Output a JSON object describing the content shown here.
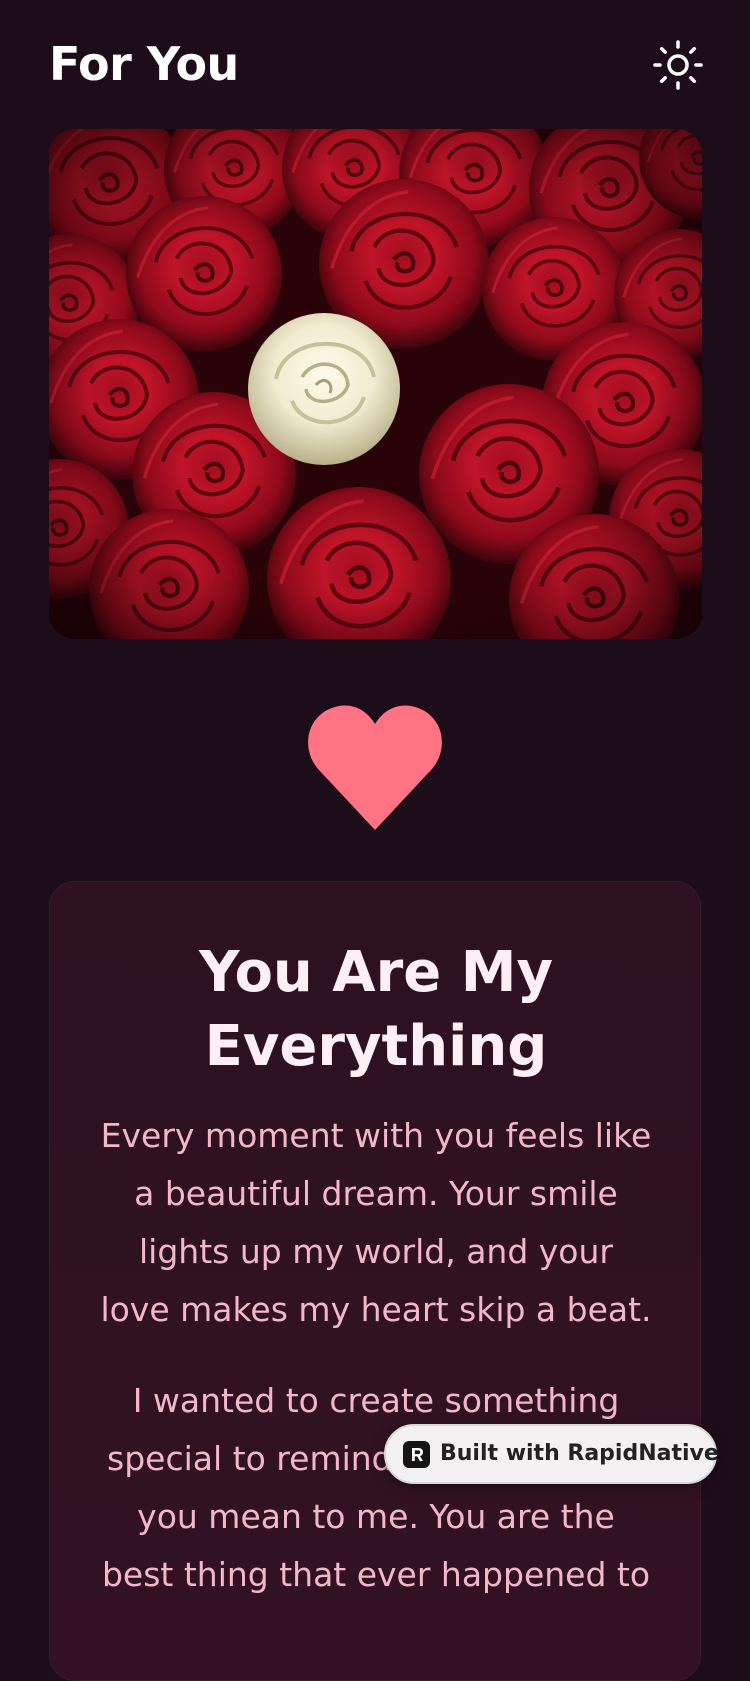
{
  "header": {
    "title": "For You",
    "theme_toggle_icon": "sun-icon"
  },
  "hero": {
    "image_description": "red-roses-with-white-rose-photo"
  },
  "heart": {
    "icon": "heart-icon",
    "color": "#ff7385"
  },
  "card": {
    "title_line1": "You Are My",
    "title_line2": "Everything",
    "paragraph1_lines": [
      "Every moment with you feels like",
      "a beautiful dream. Your smile",
      "lights up my world, and your",
      "love makes my heart skip a beat."
    ],
    "paragraph2_lines": [
      "I wanted to create something",
      "special to remind you how much",
      "you mean to me. You are the",
      "best thing that ever happened to"
    ]
  },
  "badge": {
    "label": "Built with RapidNative",
    "icon": "rapidnative-logo-icon"
  },
  "colors": {
    "background": "#1d0d18",
    "card_background": "#2f1120",
    "heart": "#ff7385",
    "title_text": "#ffffff",
    "body_text": "#f3b7c9"
  }
}
